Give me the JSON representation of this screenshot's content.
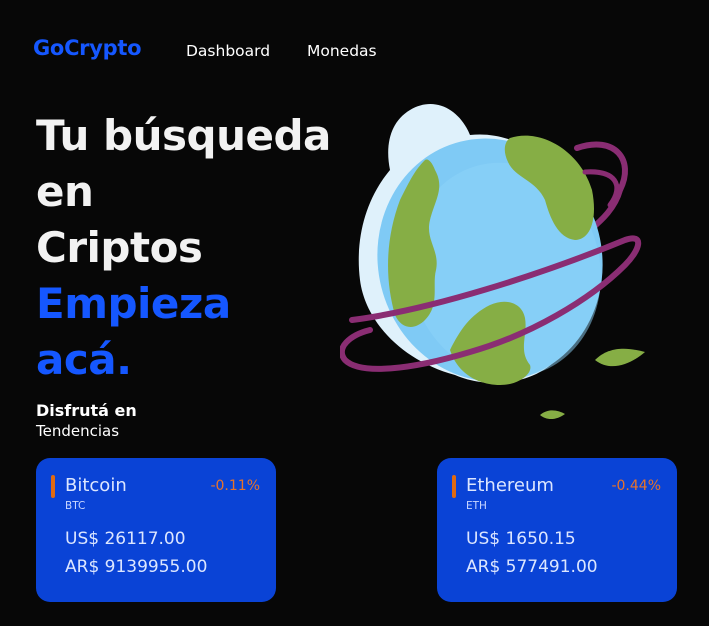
{
  "nav": {
    "logo": "GoCrypto",
    "links": [
      "Dashboard",
      "Monedas"
    ]
  },
  "hero": {
    "title_lines": [
      "Tu búsqueda",
      "en",
      "Criptos"
    ],
    "highlight_lines": [
      "Empieza",
      "acá."
    ],
    "subtitle_strong": "Disfrutá en",
    "subtitle_normal": "Tendencias"
  },
  "coins": [
    {
      "name": "Bitcoin",
      "symbol": "BTC",
      "change": "-0.11%",
      "usd": "US$ 26117.00",
      "ars": "AR$ 9139955.00"
    },
    {
      "name": "Ethereum",
      "symbol": "ETH",
      "change": "-0.44%",
      "usd": "US$ 1650.15",
      "ars": "AR$ 577491.00"
    }
  ],
  "colors": {
    "background": "#070707",
    "brand": "#1557ff",
    "card": "#0a43d6",
    "change_negative": "#e8732a",
    "globe_ocean": "#7fcaf5",
    "globe_land": "#86ae45",
    "orbit": "#8a2d73"
  },
  "illustration": {
    "icon": "globe-icon"
  }
}
